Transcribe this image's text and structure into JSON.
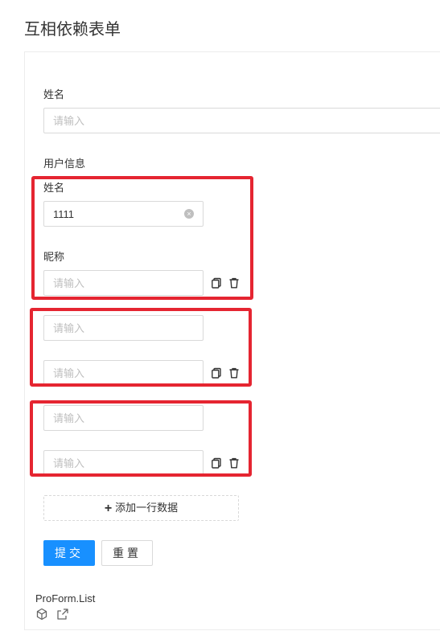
{
  "page": {
    "title": "互相依赖表单"
  },
  "form": {
    "name_label": "姓名",
    "name_placeholder": "请输入",
    "user_info_label": "用户信息",
    "list": {
      "item_name_label": "姓名",
      "item_nickname_label": "昵称",
      "rows": [
        {
          "name_value": "1111",
          "name_placeholder": "请输入",
          "nickname_placeholder": "请输入"
        },
        {
          "name_value": "",
          "name_placeholder": "请输入",
          "nickname_placeholder": "请输入"
        },
        {
          "name_value": "",
          "name_placeholder": "请输入",
          "nickname_placeholder": "请输入"
        }
      ],
      "add_row_label": "添加一行数据"
    },
    "submit_label": "提交",
    "reset_label": "重置"
  },
  "footer": {
    "title": "ProForm.List"
  },
  "colors": {
    "primary": "#1890ff",
    "highlight_border": "#e52531"
  },
  "icons": [
    "close-circle-icon",
    "copy-icon",
    "delete-icon",
    "plus-icon",
    "codesandbox-icon",
    "external-link-icon"
  ]
}
